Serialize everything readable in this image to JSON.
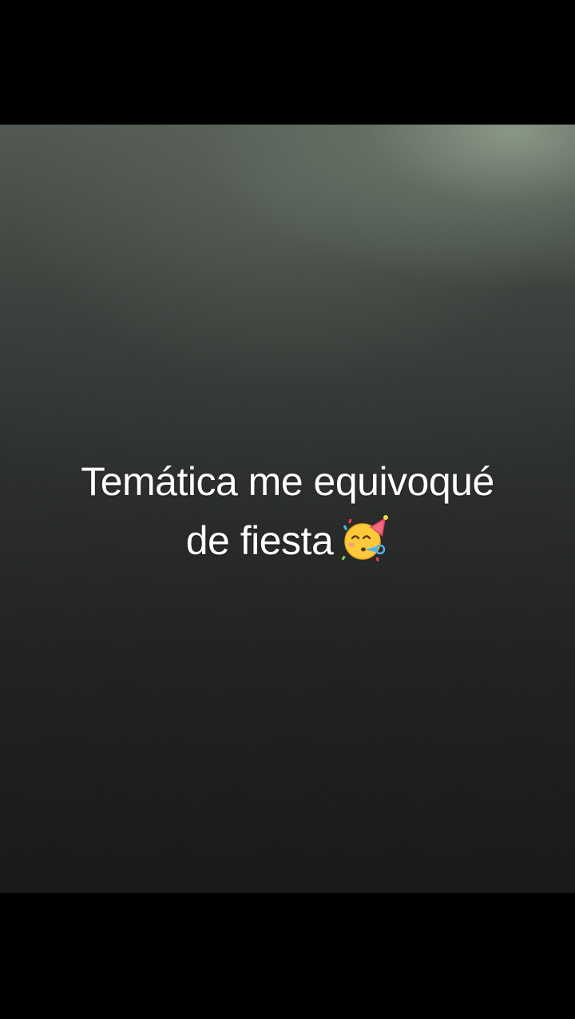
{
  "caption": {
    "line1": "Temática me equivoqué",
    "line2": "de fiesta",
    "emoji_icon": "partying-face-icon"
  },
  "colors": {
    "letterbox": "#000000",
    "caption_text": "#ffffff"
  }
}
